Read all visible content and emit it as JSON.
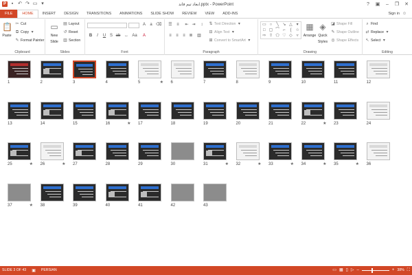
{
  "window": {
    "title": "ابعاد تیم فاند.pptx - PowerPoint",
    "controls": [
      "?",
      "▣",
      "–",
      "❐",
      "✕"
    ]
  },
  "tabs": [
    "FILE",
    "HOME",
    "INSERT",
    "DESIGN",
    "TRANSITIONS",
    "ANIMATIONS",
    "SLIDE SHOW",
    "REVIEW",
    "VIEW",
    "ADD-INS"
  ],
  "active_tab": "HOME",
  "account": {
    "label": "Sign in"
  },
  "ribbon": {
    "clipboard": {
      "paste": "Paste",
      "cut": "Cut",
      "copy": "Copy",
      "format_painter": "Format Painter",
      "group": "Clipboard"
    },
    "slides": {
      "new_slide": "New",
      "new_slide_2": "Slide",
      "layout": "Layout",
      "reset": "Reset",
      "section": "Section",
      "group": "Slides"
    },
    "font": {
      "name": "",
      "size": "",
      "group": "Font"
    },
    "paragraph": {
      "text_direction": "Text Direction",
      "align_text": "Align Text",
      "convert_smartart": "Convert to SmartArt",
      "group": "Paragraph"
    },
    "drawing": {
      "arrange": "Arrange",
      "quick_styles": "Quick",
      "quick_styles_2": "Styles",
      "shape_fill": "Shape Fill",
      "shape_outline": "Shape Outline",
      "shape_effects": "Shape Effects",
      "group": "Drawing"
    },
    "editing": {
      "find": "Find",
      "replace": "Replace",
      "select": "Select",
      "group": "Editing"
    }
  },
  "slides": [
    {
      "num": "1",
      "star": "",
      "style": "red"
    },
    {
      "num": "2",
      "star": "",
      "style": "pic"
    },
    {
      "num": "3",
      "star": "",
      "style": "dark",
      "selected": true
    },
    {
      "num": "4",
      "star": "",
      "style": "dark"
    },
    {
      "num": "5",
      "star": "★",
      "style": "white"
    },
    {
      "num": "6",
      "star": "",
      "style": "white"
    },
    {
      "num": "7",
      "star": "",
      "style": "dark"
    },
    {
      "num": "8",
      "star": "",
      "style": "white"
    },
    {
      "num": "9",
      "star": "",
      "style": "dark"
    },
    {
      "num": "10",
      "star": "",
      "style": "dark"
    },
    {
      "num": "11",
      "star": "",
      "style": "dark"
    },
    {
      "num": "12",
      "star": "",
      "style": "white"
    },
    {
      "num": "13",
      "star": "",
      "style": "dark"
    },
    {
      "num": "14",
      "star": "",
      "style": "pic"
    },
    {
      "num": "15",
      "star": "",
      "style": "dark"
    },
    {
      "num": "16",
      "star": "★",
      "style": "pic"
    },
    {
      "num": "17",
      "star": "",
      "style": "dark"
    },
    {
      "num": "18",
      "star": "",
      "style": "dark"
    },
    {
      "num": "19",
      "star": "",
      "style": "dark"
    },
    {
      "num": "20",
      "star": "",
      "style": "dark"
    },
    {
      "num": "21",
      "star": "",
      "style": "dark"
    },
    {
      "num": "22",
      "star": "★",
      "style": "pic"
    },
    {
      "num": "23",
      "star": "",
      "style": "dark"
    },
    {
      "num": "24",
      "star": "",
      "style": "white"
    },
    {
      "num": "25",
      "star": "★",
      "style": "pic"
    },
    {
      "num": "26",
      "star": "★",
      "style": "white"
    },
    {
      "num": "27",
      "star": "",
      "style": "pic"
    },
    {
      "num": "28",
      "star": "",
      "style": "dark"
    },
    {
      "num": "29",
      "star": "",
      "style": "dark"
    },
    {
      "num": "30",
      "star": "",
      "style": "photo"
    },
    {
      "num": "31",
      "star": "★",
      "style": "pic"
    },
    {
      "num": "32",
      "star": "★",
      "style": "white"
    },
    {
      "num": "33",
      "star": "★",
      "style": "dark"
    },
    {
      "num": "34",
      "star": "★",
      "style": "dark"
    },
    {
      "num": "35",
      "star": "★",
      "style": "dark"
    },
    {
      "num": "36",
      "star": "",
      "style": "white"
    },
    {
      "num": "37",
      "star": "★",
      "style": "photo"
    },
    {
      "num": "38",
      "star": "",
      "style": "dark"
    },
    {
      "num": "39",
      "star": "",
      "style": "dark"
    },
    {
      "num": "40",
      "star": "",
      "style": "pic"
    },
    {
      "num": "41",
      "star": "",
      "style": "pic"
    },
    {
      "num": "42",
      "star": "",
      "style": "photo"
    },
    {
      "num": "43",
      "star": "",
      "style": "photo"
    }
  ],
  "status": {
    "slide_info": "SLIDE 3 OF 43",
    "language": "PERSIAN",
    "zoom": "38%"
  },
  "colors": {
    "accent": "#d24726",
    "slide_bar": "#2e6fcf"
  },
  "icons": {
    "app": "powerpoint-icon"
  }
}
